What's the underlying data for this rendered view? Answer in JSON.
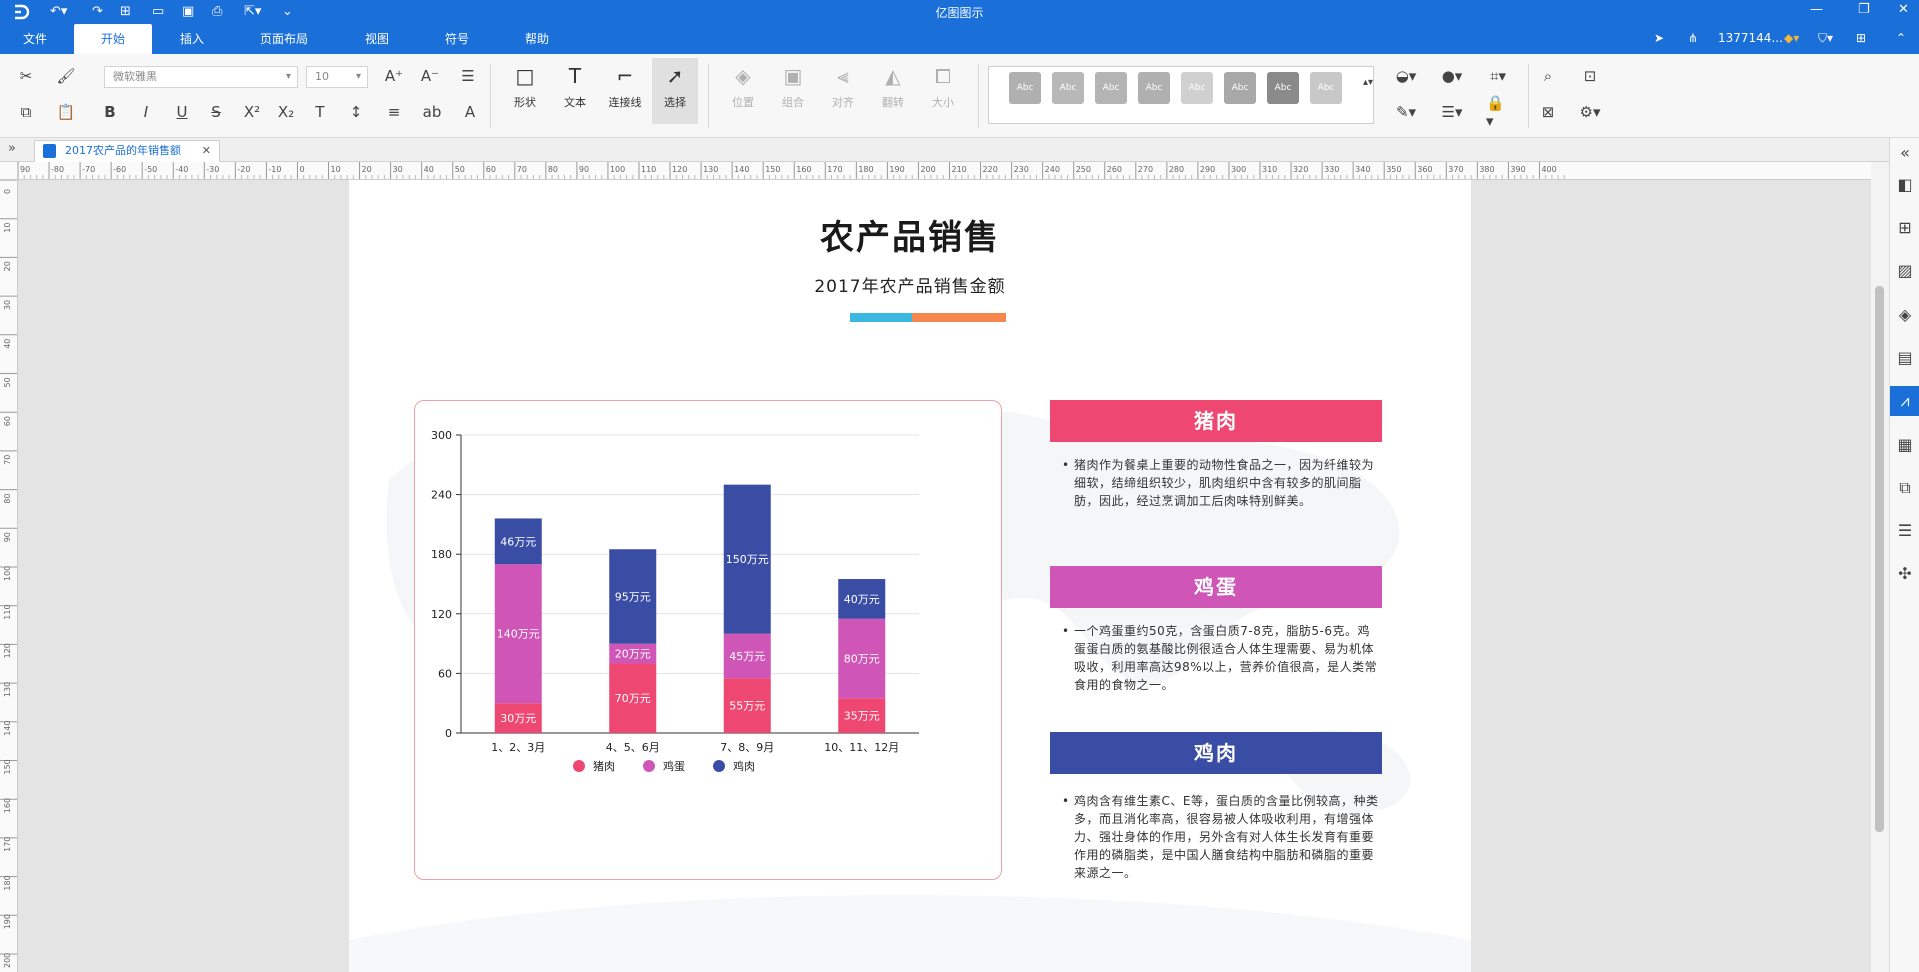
{
  "app": {
    "title": "亿图图示",
    "user": "1377144...",
    "menu": [
      "文件",
      "开始",
      "插入",
      "页面布局",
      "视图",
      "符号",
      "帮助"
    ],
    "active_menu": "开始"
  },
  "toolbar": {
    "font_name": "微软雅黑",
    "font_size": "10",
    "tools": [
      {
        "label": "形状",
        "icon": "rectangle-icon"
      },
      {
        "label": "文本",
        "icon": "text-icon"
      },
      {
        "label": "连接线",
        "icon": "connector-icon"
      },
      {
        "label": "选择",
        "icon": "select-arrow-icon"
      },
      {
        "label": "位置",
        "icon": "position-icon"
      },
      {
        "label": "组合",
        "icon": "group-icon"
      },
      {
        "label": "对齐",
        "icon": "align-icon"
      },
      {
        "label": "翻转",
        "icon": "flip-icon"
      },
      {
        "label": "大小",
        "icon": "size-icon"
      }
    ],
    "style_swatch_label": "Abc",
    "style_swatches": [
      "#b0b0b0",
      "#b8b8b8",
      "#b4b4b4",
      "#b0b0b0",
      "#d0d0d0",
      "#a8a8a8",
      "#8a8a8a",
      "#c8c8c8"
    ]
  },
  "tabs": [
    {
      "label": "2017农产品的年销售额"
    }
  ],
  "rulers": {
    "h_labels": [
      "90",
      "-80",
      "-70",
      "-60",
      "-50",
      "-40",
      "-30",
      "-20",
      "-10",
      "0",
      "10",
      "20",
      "30",
      "40",
      "50",
      "60",
      "70",
      "80",
      "90",
      "100",
      "110",
      "120",
      "130",
      "140",
      "150",
      "160",
      "170",
      "180",
      "190",
      "200",
      "210",
      "220",
      "230",
      "240",
      "250",
      "260",
      "270",
      "280",
      "290",
      "300",
      "310",
      "320",
      "330",
      "340",
      "350",
      "360",
      "370",
      "380",
      "390",
      "400"
    ],
    "v_labels": [
      "0",
      "10",
      "20",
      "30",
      "40",
      "50",
      "60",
      "70",
      "80",
      "90",
      "100",
      "110",
      "120",
      "130",
      "140",
      "150",
      "160",
      "170",
      "180",
      "190",
      "200"
    ]
  },
  "document": {
    "title": "农产品销售",
    "subtitle": "2017年农产品销售金额",
    "accent_colors": [
      "#3bb8e0",
      "#f5874e"
    ],
    "sections": [
      {
        "heading": "猪肉",
        "color": "#ee4771",
        "body": "猪肉作为餐桌上重要的动物性食品之一，因为纤维较为细软，结缔组织较少，肌肉组织中含有较多的肌间脂肪，因此，经过烹调加工后肉味特别鲜美。"
      },
      {
        "heading": "鸡蛋",
        "color": "#cf56b7",
        "body": "一个鸡蛋重约50克，含蛋白质7-8克，脂肪5-6克。鸡蛋蛋白质的氨基酸比例很适合人体生理需要、易为机体吸收，利用率高达98%以上，营养价值很高，是人类常食用的食物之一。"
      },
      {
        "heading": "鸡肉",
        "color": "#3a4da5",
        "body": "鸡肉含有维生素C、E等，蛋白质的含量比例较高，种类多，而且消化率高，很容易被人体吸收利用，有增强体力、强壮身体的作用，另外含有对人体生长发育有重要作用的磷脂类，是中国人膳食结构中脂肪和磷脂的重要来源之一。"
      }
    ]
  },
  "chart_data": {
    "type": "bar",
    "stacked": true,
    "categories": [
      "1、2、3月",
      "4、5、6月",
      "7、8、9月",
      "10、11、12月"
    ],
    "series": [
      {
        "name": "猪肉",
        "color": "#ee4771",
        "values": [
          30,
          70,
          55,
          35
        ],
        "labels": [
          "30万元",
          "70万元",
          "55万元",
          "35万元"
        ]
      },
      {
        "name": "鸡蛋",
        "color": "#cf56b7",
        "values": [
          140,
          20,
          45,
          80
        ],
        "labels": [
          "140万元",
          "20万元",
          "45万元",
          "80万元"
        ]
      },
      {
        "name": "鸡肉",
        "color": "#3a4da5",
        "values": [
          46,
          95,
          150,
          40
        ],
        "labels": [
          "46万元",
          "95万元",
          "150万元",
          "40万元"
        ]
      }
    ],
    "yticks": [
      "0",
      "60",
      "120",
      "180",
      "240",
      "300"
    ],
    "ylim": [
      0,
      300
    ],
    "grid": true,
    "legend": "bottom"
  }
}
